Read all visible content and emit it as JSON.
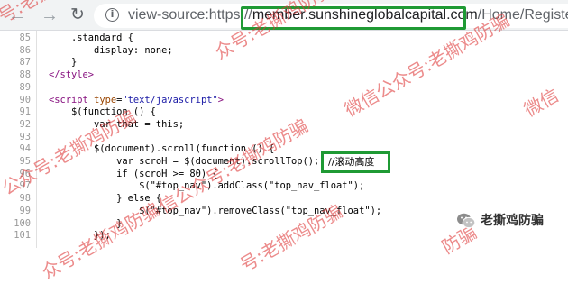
{
  "toolbar": {
    "back_icon": "back-arrow-icon",
    "forward_icon": "forward-arrow-icon",
    "reload_icon": "reload-icon",
    "info_icon": "info-icon"
  },
  "address": {
    "scheme": "view-source:https://",
    "host": "member.sunshineglobalcapital.com",
    "path": "/Home/Register"
  },
  "code_lines": [
    {
      "num": "85",
      "code": "    .standard {"
    },
    {
      "num": "86",
      "code": "        display: none;"
    },
    {
      "num": "87",
      "code": "    }"
    },
    {
      "num": "88",
      "code": "</style>"
    },
    {
      "num": "89",
      "code": ""
    },
    {
      "num": "90",
      "code": "<script type=\"text/javascript\">"
    },
    {
      "num": "91",
      "code": "    $(function () {"
    },
    {
      "num": "92",
      "code": "        var that = this;"
    },
    {
      "num": "93",
      "code": ""
    },
    {
      "num": "94",
      "code": "        $(document).scroll(function () {"
    },
    {
      "num": "95",
      "code": "            var scroH = $(document).scrollTop();"
    },
    {
      "num": "96",
      "code": "            if (scroH >= 80) {"
    },
    {
      "num": "97",
      "code": "                $(\"#top_nav\").addClass(\"top_nav_float\");"
    },
    {
      "num": "98",
      "code": "            } else {"
    },
    {
      "num": "99",
      "code": "                $(\"#top_nav\").removeClass(\"top_nav_float\");"
    },
    {
      "num": "100",
      "code": "            }"
    },
    {
      "num": "101",
      "code": "        });"
    }
  ],
  "highlighted_comment": "//滚动高度",
  "watermarks": [
    "号:老撕鸡防骗",
    "众号:老撕鸡防骗",
    "微信公众号:老撕鸡防骗",
    "微信",
    "公众号:老撕鸡防骗",
    "信公众号:老撕鸡防骗",
    "号:老撕鸡防骗",
    "防骗",
    "众号:老撕鸡防骗"
  ],
  "wechat_mark": {
    "icon": "wechat-logo-icon",
    "label": "老撕鸡防骗"
  },
  "colors": {
    "highlight_box": "#1f9a34",
    "watermark": "#de3737",
    "tag": "#881280"
  }
}
